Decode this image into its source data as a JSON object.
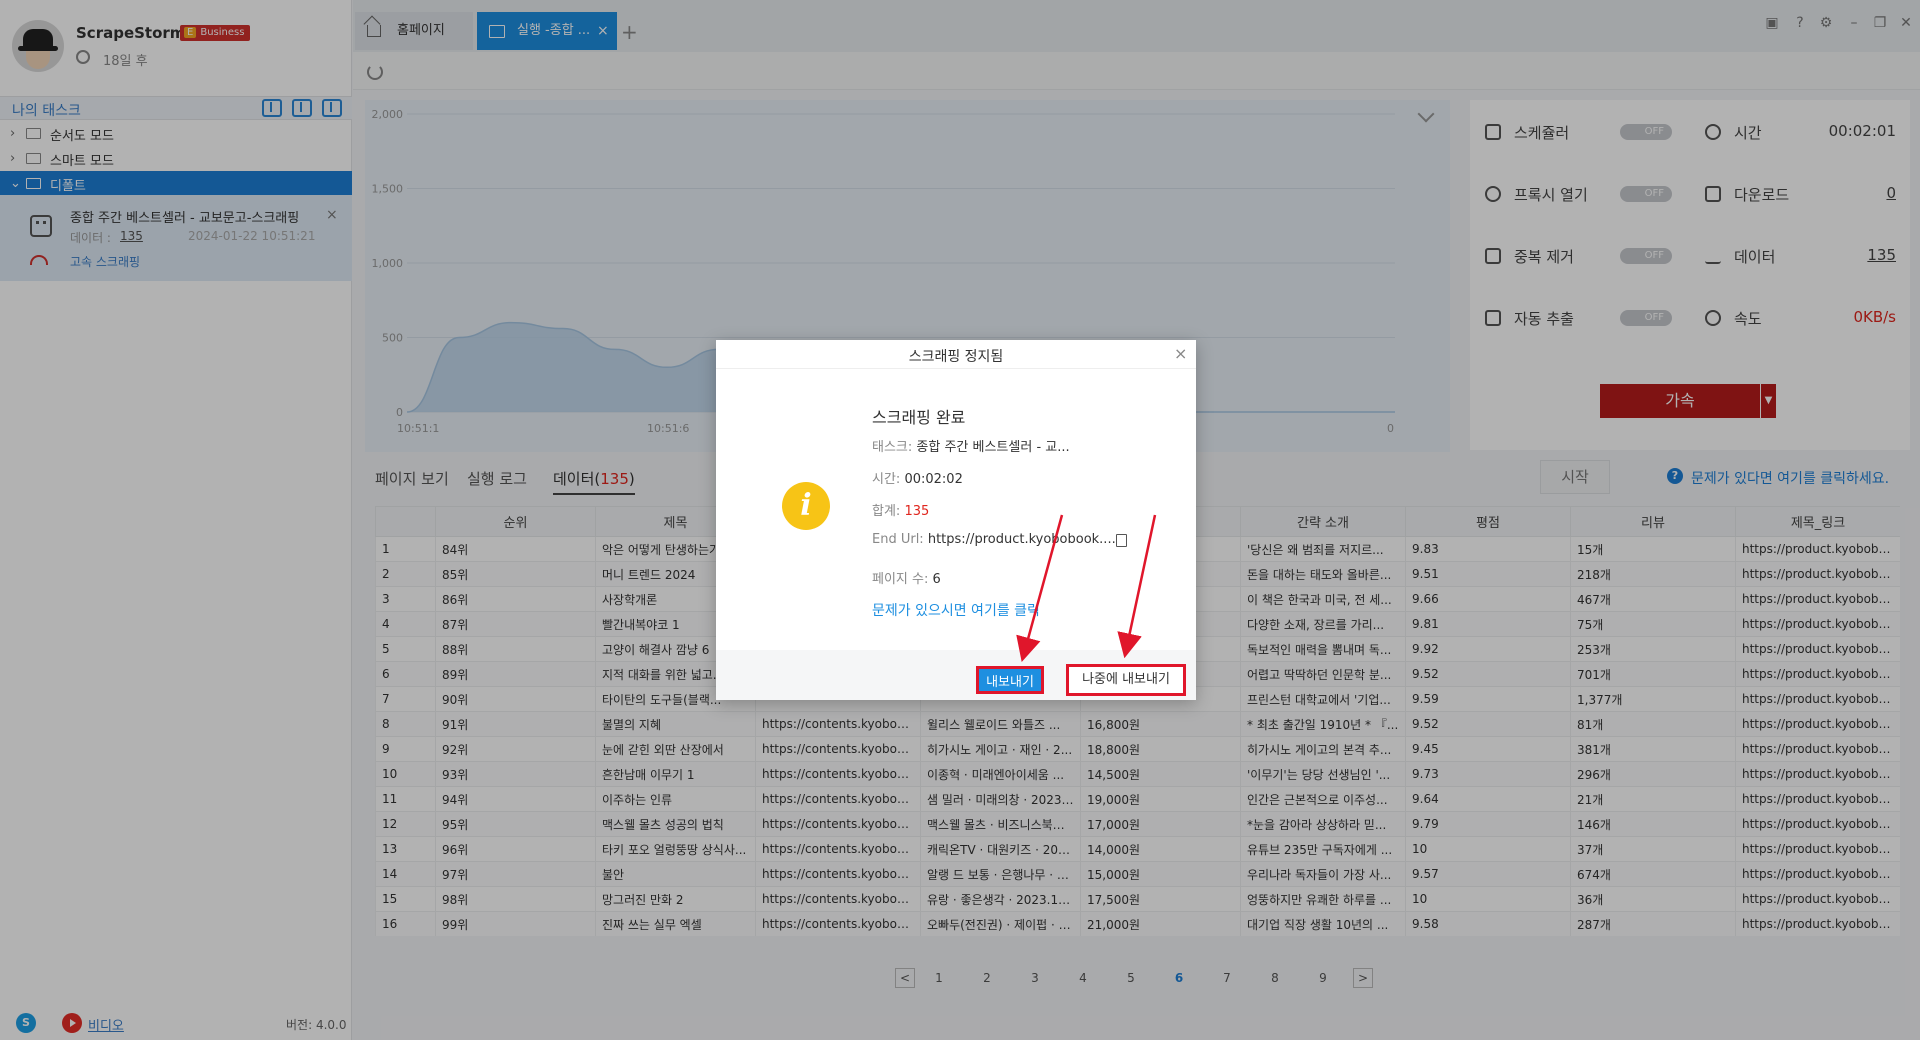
{
  "sidebar": {
    "app_name": "ScrapeStorm",
    "plan_badge_prefix": "E",
    "plan_badge": "Business",
    "remaining": "18일 후",
    "task_header": "나의 태스크",
    "tree": [
      {
        "label": "순서도 모드"
      },
      {
        "label": "스마트 모드"
      },
      {
        "label": "디폴트"
      }
    ],
    "task": {
      "name": "종합 주간 베스트셀러 - 교보문고-스크래핑",
      "data_label": "데이터 :",
      "data_value": "135",
      "date": "2024-01-22 10:51:21",
      "mode": "고속 스크래핑"
    },
    "footer": {
      "video": "비디오",
      "version": "버전: 4.0.0"
    }
  },
  "tabs": {
    "home": "홈페이지",
    "run": "실행 -종합 ...",
    "close": "×",
    "add": "+"
  },
  "chart_data": {
    "type": "area",
    "x_ticks": [
      "10:51:1",
      "10:51:6"
    ],
    "y_ticks": [
      "0",
      "500",
      "1,000",
      "1,500",
      "2,000"
    ],
    "ylim": [
      0,
      2000
    ],
    "series": [
      {
        "values": [
          0,
          500,
          600,
          560,
          420,
          300,
          420,
          0,
          0,
          0,
          0,
          0,
          0,
          0,
          0,
          0,
          0,
          0,
          0,
          0
        ]
      }
    ],
    "right_label": "0",
    "color": "#b9d3ea"
  },
  "stats": {
    "scheduler": "스케쥴러",
    "scheduler_state": "OFF",
    "time_label": "시간",
    "time_value": "00:02:01",
    "proxy": "프록시 열기",
    "proxy_state": "OFF",
    "download_label": "다운로드",
    "download_value": "0",
    "dedupe": "중복 제거",
    "dedupe_state": "OFF",
    "data_label": "데이터",
    "data_value": "135",
    "auto": "자동 추출",
    "auto_state": "OFF",
    "speed_label": "속도",
    "speed_value": "0KB/s",
    "boost": "가속"
  },
  "data_tabs": {
    "page_view": "페이지 보기",
    "run_log": "실행 로그",
    "data": "데이터(",
    "data_count": "135",
    "data_close": ")",
    "start": "시작",
    "help": "문제가 있다면 여기를 클릭하세요."
  },
  "table": {
    "headers": [
      "",
      "순위",
      "제목",
      "",
      "",
      "",
      "간략 소개",
      "평점",
      "리뷰",
      "제목_링크"
    ],
    "rows": [
      [
        "1",
        "84위",
        "악은 어떻게 탄생하는가",
        "",
        "",
        "",
        "'당신은 왜 범죄를 저지르...",
        "9.83",
        "15개",
        "https://product.kyobobook..."
      ],
      [
        "2",
        "85위",
        "머니 트렌드 2024",
        "",
        "",
        "",
        "돈을 대하는 태도와 올바른...",
        "9.51",
        "218개",
        "https://product.kyobobook..."
      ],
      [
        "3",
        "86위",
        "사장학개론",
        "",
        "",
        "",
        "이 책은 한국과 미국, 전 세...",
        "9.66",
        "467개",
        "https://product.kyobobook..."
      ],
      [
        "4",
        "87위",
        "빨간내복야코 1",
        "",
        "",
        "",
        "다양한 소재, 장르를 가리...",
        "9.81",
        "75개",
        "https://product.kyobobook..."
      ],
      [
        "5",
        "88위",
        "고양이 해결사 깜냥 6",
        "",
        "",
        "",
        "독보적인 매력을 뽐내며 독...",
        "9.92",
        "253개",
        "https://product.kyobobook..."
      ],
      [
        "6",
        "89위",
        "지적 대화를 위한 넓고...",
        "",
        "",
        "",
        "어렵고 딱딱하던 인문학 분...",
        "9.52",
        "701개",
        "https://product.kyobobook..."
      ],
      [
        "7",
        "90위",
        "타이탄의 도구들(블랙...",
        "",
        "",
        "",
        "프린스턴 대학교에서 '기업...",
        "9.59",
        "1,377개",
        "https://product.kyobobook..."
      ],
      [
        "8",
        "91위",
        "불멸의 지혜",
        "https://contents.kyobobook...",
        "윌리스 웰로이드 와틀즈 ...",
        "16,800원",
        "* 최초 출간일 1910년 * 『...",
        "9.52",
        "81개",
        "https://product.kyobobook..."
      ],
      [
        "9",
        "92위",
        "눈에 갇힌 외딴 산장에서",
        "https://contents.kyobobook...",
        "히가시노 게이고 · 재인 · 2...",
        "18,800원",
        "히가시노 게이고의 본격 추...",
        "9.45",
        "381개",
        "https://product.kyobobook..."
      ],
      [
        "10",
        "93위",
        "흔한남매 이무기 1",
        "https://contents.kyobobook...",
        "이종혁 · 미래엔아이세움 ...",
        "14,500원",
        "'이무기'는 당당 선생님인 '...",
        "9.73",
        "296개",
        "https://product.kyobobook..."
      ],
      [
        "11",
        "94위",
        "이주하는 인류",
        "https://contents.kyobobook...",
        "샘 밀러 · 미래의창 · 2023....",
        "19,000원",
        "인간은 근본적으로 이주성...",
        "9.64",
        "21개",
        "https://product.kyobobook..."
      ],
      [
        "12",
        "95위",
        "맥스웰 몰츠 성공의 법칙",
        "https://contents.kyobobook...",
        "맥스웰 몰츠 · 비즈니스북스 ...",
        "17,000원",
        "*눈을 감아라 상상하라 믿...",
        "9.79",
        "146개",
        "https://product.kyobobook..."
      ],
      [
        "13",
        "96위",
        "타키 포오 얼렁뚱땅 상식사...",
        "https://contents.kyobobook...",
        "캐릭온TV · 대원키즈 · 202...",
        "14,000원",
        "유튜브 235만 구독자에게 ...",
        "10",
        "37개",
        "https://product.kyobobook..."
      ],
      [
        "14",
        "97위",
        "불안",
        "https://contents.kyobobook...",
        "알랭 드 보통 · 은행나무 · 2...",
        "15,000원",
        "우리나라 독자들이 가장 사...",
        "9.57",
        "674개",
        "https://product.kyobobook..."
      ],
      [
        "15",
        "98위",
        "망그러진 만화 2",
        "https://contents.kyobobook...",
        "유랑 · 좋은생각 · 2023.12.25",
        "17,500원",
        "엉뚱하지만 유쾌한 하루를 ...",
        "10",
        "36개",
        "https://product.kyobobook..."
      ],
      [
        "16",
        "99위",
        "진짜 쓰는 실무 엑셀",
        "https://contents.kyobobook...",
        "오빠두(전진권) · 제이펍 · 2...",
        "21,000원",
        "대기업 직장 생활 10년의 ...",
        "9.58",
        "287개",
        "https://product.kyobobook..."
      ]
    ]
  },
  "pager": {
    "prev": "<",
    "pages": [
      "1",
      "2",
      "3",
      "4",
      "5",
      "6",
      "7",
      "8",
      "9"
    ],
    "active": "6",
    "next": ">"
  },
  "modal": {
    "title": "스크래핑 정지됨",
    "close": "×",
    "heading": "스크래핑 완료",
    "task_label": "태스크:",
    "task_value": "종합 주간 베스트셀러 - 교...",
    "time_label": "시간:",
    "time_value": "00:02:02",
    "total_label": "합계:",
    "total_value": "135",
    "end_url_label": "End Url:",
    "end_url_value": "https://product.kyobobook....",
    "pages_label": "페이지 수:",
    "pages_value": "6",
    "help": "문제가 있으시면 여기를 클릭",
    "export": "내보내기",
    "later": "나중에 내보내기"
  }
}
